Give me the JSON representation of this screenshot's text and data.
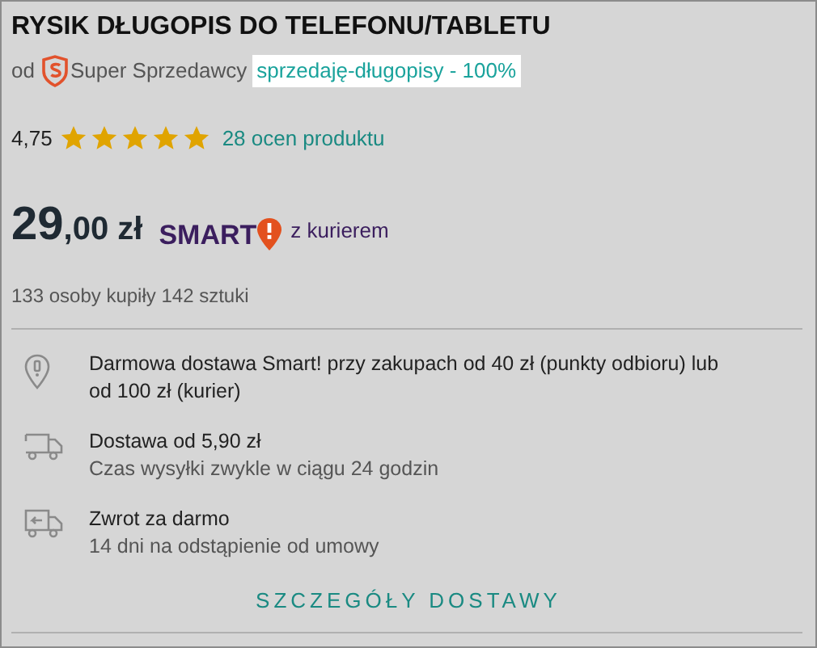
{
  "title": "RYSIK DŁUGOPIS DO TELEFONU/TABLETU",
  "seller": {
    "prefix": "od",
    "badge": "Super Sprzedawcy",
    "name": "sprzedaję-długopisy - 100%"
  },
  "rating": {
    "value": "4,75",
    "stars": 5,
    "reviews": "28 ocen produktu"
  },
  "price": {
    "main": "29",
    "cents": ",00 zł",
    "smart": "SMART",
    "smart_note": "z kurierem"
  },
  "sold": "133 osoby kupiły 142 sztuki",
  "delivery": [
    {
      "kind": "pin",
      "title": "Darmowa dostawa Smart! przy zakupach od 40 zł (punkty odbioru) lub od 100 zł (kurier)"
    },
    {
      "kind": "truck",
      "title": "Dostawa od 5,90 zł",
      "subtitle": "Czas wysyłki zwykle w ciągu 24 godzin"
    },
    {
      "kind": "return",
      "title": "Zwrot za darmo",
      "subtitle": "14 dni na odstąpienie od umowy"
    }
  ],
  "details_link": "SZCZEGÓŁY DOSTAWY"
}
